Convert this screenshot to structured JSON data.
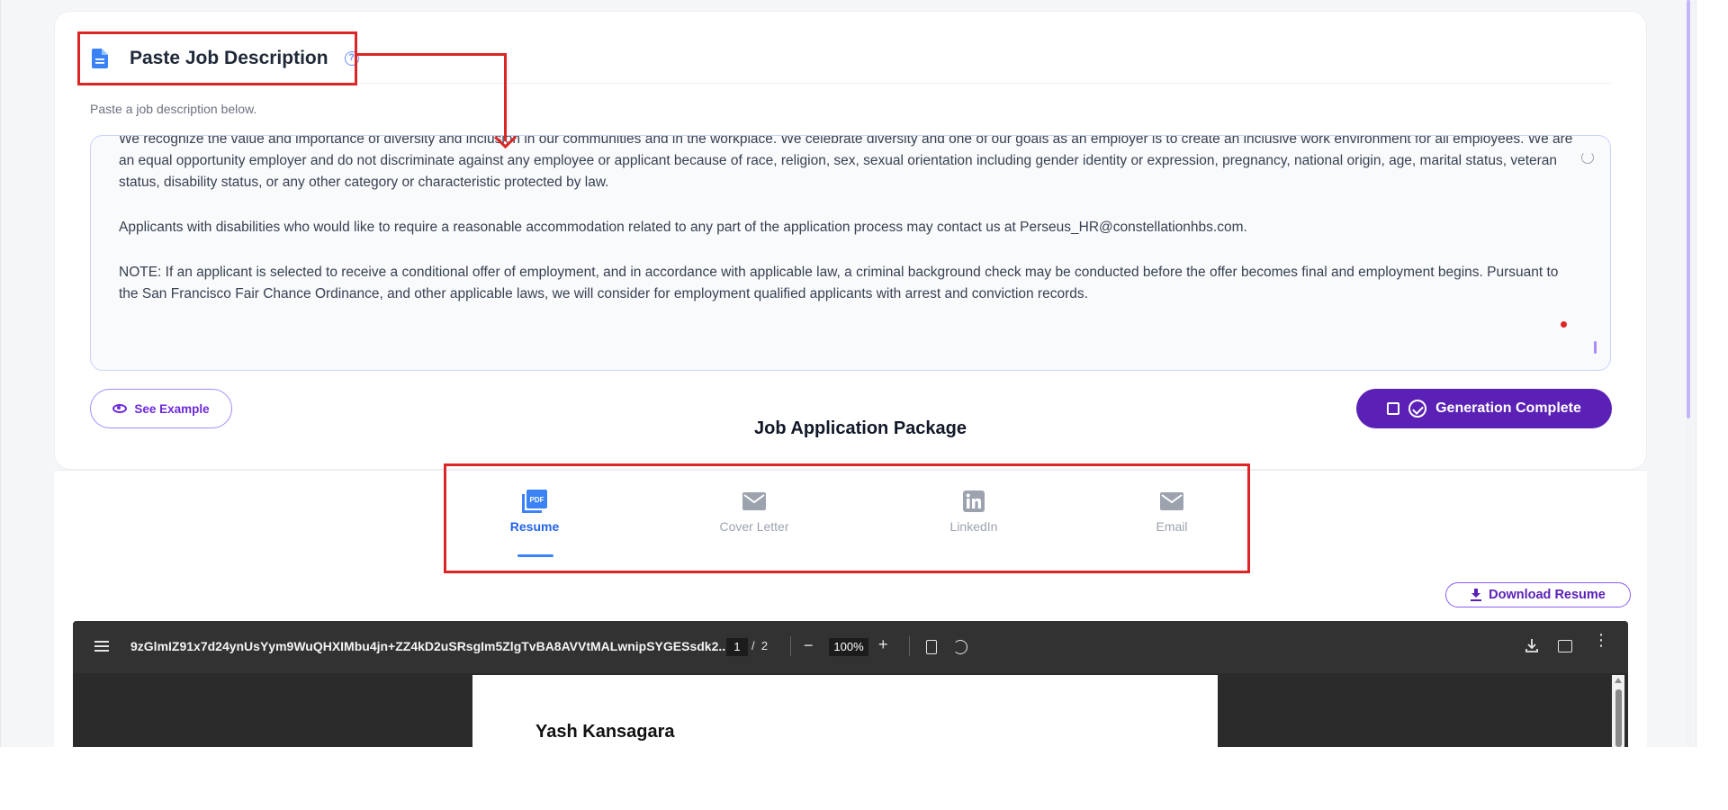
{
  "section": {
    "title": "Paste Job Description",
    "help_icon": "?",
    "sub_label": "Paste a job description below."
  },
  "job_description": {
    "paragraphs": {
      "p0": "We recognize the value and importance of diversity and inclusion in our communities and in the workplace. We celebrate diversity and one of our goals as an employer is to create an inclusive work environment for all employees. We are an equal opportunity employer and do not discriminate against any employee or applicant because of race, religion, sex, sexual orientation including gender identity or expression, pregnancy, national origin, age, marital status, veteran status, disability status, or any other category or characteristic protected by law.",
      "p1": "Applicants with disabilities who would like to require a reasonable accommodation related to any part of the application process may contact us at Perseus_HR@constellationhbs.com.",
      "p2": "NOTE: If an applicant is selected to receive a conditional offer of employment, and in accordance with applicable law, a criminal background check may be conducted before the offer becomes final and employment begins. Pursuant to the San Francisco Fair Chance Ordinance, and other applicable laws, we will consider for employment qualified applicants with arrest and conviction records."
    }
  },
  "buttons": {
    "see_example": "See Example",
    "generation_complete": "Generation Complete",
    "download_resume": "Download Resume"
  },
  "package": {
    "title": "Job Application Package",
    "tabs": {
      "resume": "Resume",
      "cover_letter": "Cover Letter",
      "linkedin": "LinkedIn",
      "email": "Email"
    },
    "pdf_badge": "PDF"
  },
  "pdf_viewer": {
    "filename": "9zGlmIZ91x7d24ynUsYym9WuQHXIMbu4jn+ZZ4kD2uSRsgIm5ZlgTvBA8AVVtMALwnipSYGESsdk2...",
    "current_page": "1",
    "page_separator": "/",
    "total_pages": "2",
    "zoom": "100%",
    "minus": "−",
    "plus": "+",
    "more": "⋮",
    "document_name": "Yash Kansagara"
  },
  "colors": {
    "accent": "#5b21b6",
    "active_tab": "#2563eb",
    "annotation": "#dc2626"
  }
}
